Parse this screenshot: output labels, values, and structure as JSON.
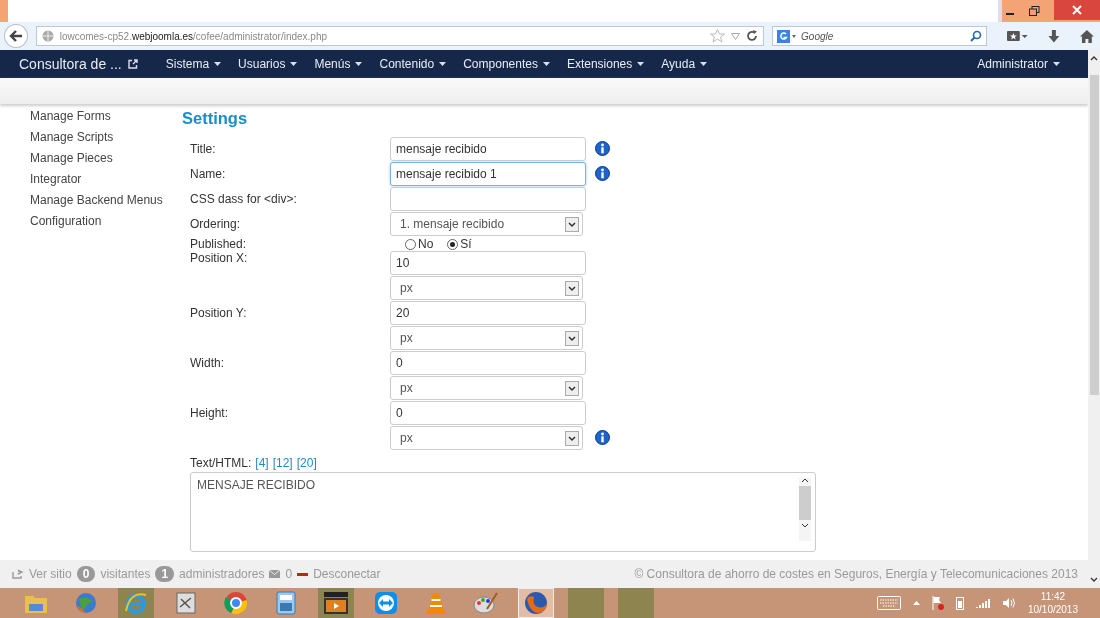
{
  "browser": {
    "url": "lowcomes-cp52.**webjoomla.es**/cofee/administrator/index.php",
    "search": {
      "placeholder": "Google"
    }
  },
  "navbar": {
    "brand": "Consultora de ...",
    "menus": [
      {
        "label": "Sistema"
      },
      {
        "label": "Usuarios"
      },
      {
        "label": "Menús"
      },
      {
        "label": "Contenido"
      },
      {
        "label": "Componentes"
      },
      {
        "label": "Extensiones"
      },
      {
        "label": "Ayuda"
      }
    ],
    "user": "Administrator"
  },
  "sidebar": {
    "items": [
      "Manage Forms",
      "Manage Scripts",
      "Manage Pieces",
      "Integrator",
      "Manage Backend Menus",
      "Configuration"
    ]
  },
  "settings": {
    "heading": "Settings",
    "fields": [
      {
        "kind": "text",
        "label": "Title:",
        "value": "mensaje recibido",
        "info": true,
        "focused": false
      },
      {
        "kind": "text",
        "label": "Name:",
        "value": "mensaje recibido 1",
        "info": true,
        "focused": true
      },
      {
        "kind": "text",
        "label": "CSS dass for <div>:",
        "info": false,
        "focused": false
      },
      {
        "kind": "select",
        "label": "Ordering:",
        "value": "1. mensaje recibido",
        "info": false
      },
      {
        "kind": "radio",
        "label": "Published:",
        "options": [
          {
            "label": "No",
            "selected": false
          },
          {
            "label": "Sí",
            "selected": true
          }
        ]
      },
      {
        "kind": "text",
        "label": "Position X:",
        "value": "10",
        "info": false,
        "focused": false
      },
      {
        "kind": "select",
        "value": "px",
        "info": false
      },
      {
        "kind": "text",
        "label": "Position Y:",
        "value": "20",
        "info": false,
        "focused": false
      },
      {
        "kind": "select",
        "value": "px",
        "info": false
      },
      {
        "kind": "text",
        "label": "Width:",
        "value": "0",
        "info": false,
        "focused": false
      },
      {
        "kind": "select",
        "value": "px",
        "info": false
      },
      {
        "kind": "text",
        "label": "Height:",
        "value": "0",
        "info": false,
        "focused": false
      },
      {
        "kind": "select",
        "value": "px",
        "info": true
      }
    ],
    "text_html": {
      "label": "Text/HTML:",
      "links": [
        "[4]",
        "[12]",
        "[20]"
      ],
      "value": "MENSAJE RECIBIDO"
    }
  },
  "footer": {
    "view_site": "Ver sitio",
    "visitors_count": "0",
    "visitors": "visitantes",
    "admins_count": "1",
    "admins": "administradores",
    "messages": "0",
    "logout": "Desconectar",
    "copyright": "© Consultora de ahorro de costes en Seguros, Energía y Telecomunicaciones 2013"
  },
  "taskbar": {
    "apps": [
      {
        "kind": "folder",
        "running": false,
        "selected": false
      },
      {
        "kind": "globe",
        "running": false,
        "selected": false
      },
      {
        "kind": "ring",
        "running": true,
        "selected": false
      },
      {
        "kind": "document",
        "running": false,
        "selected": false
      },
      {
        "kind": "round",
        "running": false,
        "selected": false
      },
      {
        "kind": "calculator",
        "running": false,
        "selected": false
      },
      {
        "kind": "clapperboard",
        "running": true,
        "selected": false
      },
      {
        "kind": "arrows",
        "running": false,
        "selected": false
      },
      {
        "kind": "cone",
        "running": false,
        "selected": false
      },
      {
        "kind": "palette",
        "running": false,
        "selected": false
      },
      {
        "kind": "fox",
        "running": false,
        "selected": true
      },
      {
        "kind": "blank",
        "running": true,
        "selected": false
      },
      {
        "kind": "blank",
        "running": true,
        "selected": false
      }
    ],
    "time": "11:42",
    "date": "10/10/2013"
  }
}
